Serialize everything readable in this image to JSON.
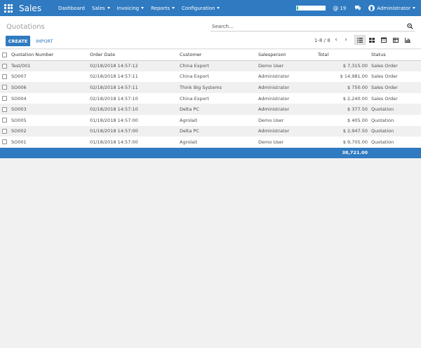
{
  "navbar": {
    "app_name": "Sales",
    "menu": [
      {
        "label": "Dashboard",
        "has_caret": false
      },
      {
        "label": "Sales",
        "has_caret": true
      },
      {
        "label": "Invoicing",
        "has_caret": true
      },
      {
        "label": "Reports",
        "has_caret": true
      },
      {
        "label": "Configuration",
        "has_caret": true
      }
    ],
    "notification_count": "19",
    "user_name": "Administrator"
  },
  "control_panel": {
    "breadcrumb": "Quotations",
    "search_placeholder": "Search...",
    "create_label": "CREATE",
    "import_label": "IMPORT",
    "pager_text": "1-8 / 8",
    "views": [
      "list-view-icon",
      "kanban-view-icon",
      "calendar-view-icon",
      "pivot-view-icon",
      "graph-view-icon"
    ],
    "active_view": "list-view-icon"
  },
  "table": {
    "columns": [
      "Quotation Number",
      "Order Date",
      "Customer",
      "Salesperson",
      "Total",
      "Status"
    ],
    "rows": [
      {
        "number": "Test/001",
        "date": "02/18/2018 14:57:12",
        "customer": "China Export",
        "salesperson": "Demo User",
        "total": "$ 7,315.00",
        "status": "Sales Order"
      },
      {
        "number": "SO007",
        "date": "02/18/2018 14:57:11",
        "customer": "China Export",
        "salesperson": "Administrator",
        "total": "$ 14,981.00",
        "status": "Sales Order"
      },
      {
        "number": "SO006",
        "date": "02/18/2018 14:57:11",
        "customer": "Think Big Systems",
        "salesperson": "Administrator",
        "total": "$ 750.00",
        "status": "Sales Order"
      },
      {
        "number": "SO004",
        "date": "02/18/2018 14:57:10",
        "customer": "China Export",
        "salesperson": "Administrator",
        "total": "$ 2,240.00",
        "status": "Sales Order"
      },
      {
        "number": "SO003",
        "date": "02/18/2018 14:57:10",
        "customer": "Delta PC",
        "salesperson": "Administrator",
        "total": "$ 377.50",
        "status": "Quotation"
      },
      {
        "number": "SO005",
        "date": "01/18/2018 14:57:00",
        "customer": "Agrolait",
        "salesperson": "Demo User",
        "total": "$ 405.00",
        "status": "Quotation"
      },
      {
        "number": "SO002",
        "date": "01/18/2018 14:57:00",
        "customer": "Delta PC",
        "salesperson": "Administrator",
        "total": "$ 2,947.50",
        "status": "Quotation"
      },
      {
        "number": "SO001",
        "date": "01/18/2018 14:57:00",
        "customer": "Agrolait",
        "salesperson": "Demo User",
        "total": "$ 9,705.00",
        "status": "Quotation"
      }
    ],
    "footer_total": "38,721.00"
  },
  "colors": {
    "brand": "#2f7ac0",
    "progress_accent": "#21b799"
  }
}
